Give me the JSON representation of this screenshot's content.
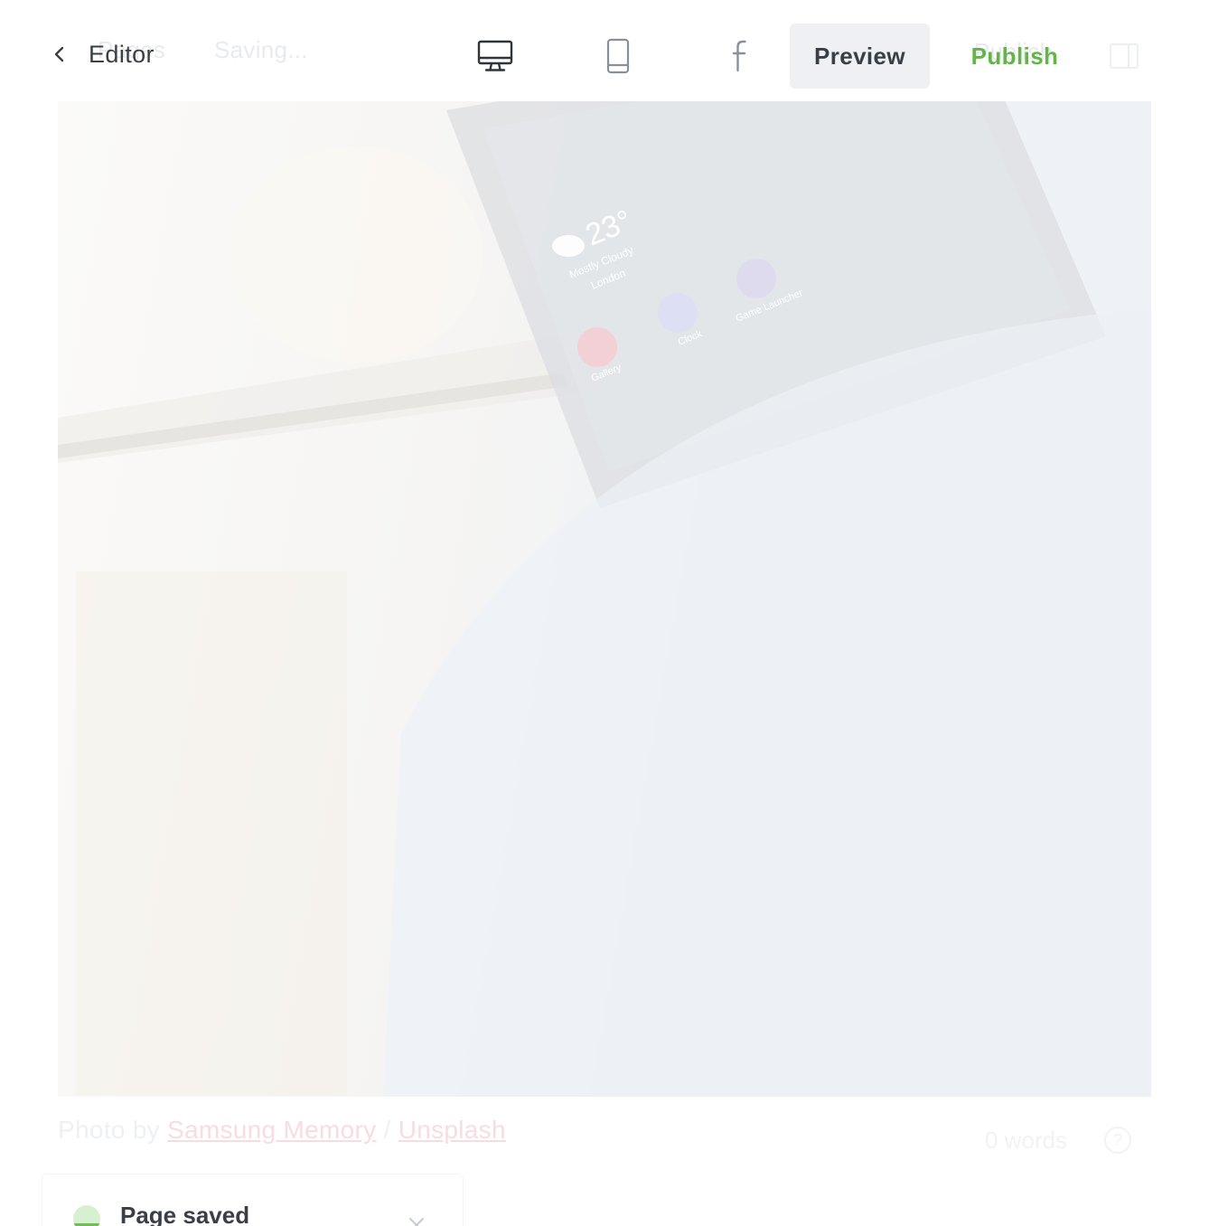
{
  "header": {
    "back_label": "Editor",
    "faded_pages_label": "Pages",
    "faded_status": "Saving...",
    "preview_label": "Preview",
    "publish_label": "Publish"
  },
  "colors": {
    "publish": "#63b549",
    "text": "#3a3f47",
    "preview_bg": "#eef0f3"
  },
  "hero": {
    "phone_temperature": "23°",
    "phone_weather": "Mostly Cloudy",
    "phone_city": "London",
    "phone_apps": [
      "Gallery",
      "Clock",
      "Game Launcher"
    ]
  },
  "caption": {
    "prefix": "Photo by",
    "author": "Samsung Memory",
    "separator": "/",
    "source": "Unsplash"
  },
  "footer": {
    "word_count": "0 words",
    "help_symbol": "?"
  },
  "toast": {
    "message": "Page saved"
  }
}
